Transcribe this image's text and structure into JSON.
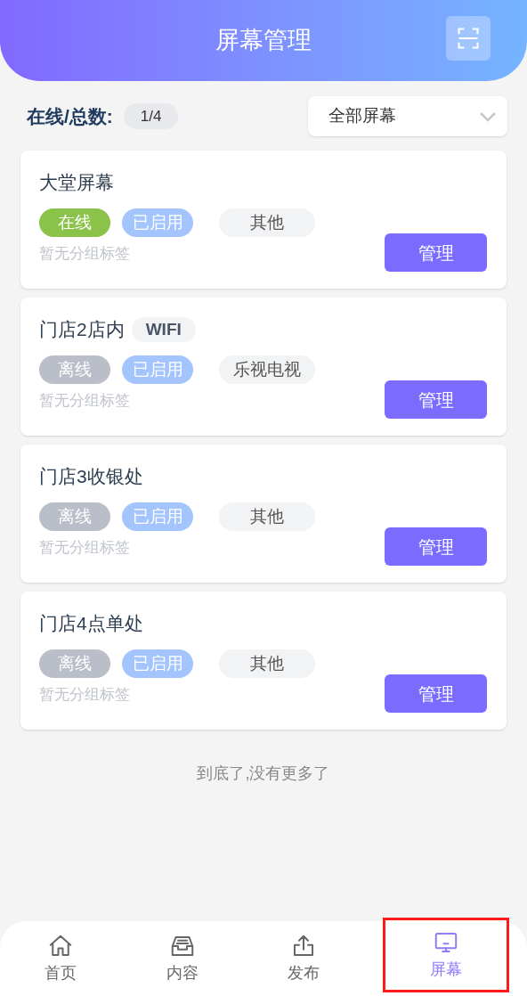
{
  "header": {
    "title": "屏幕管理"
  },
  "summary": {
    "label": "在线/总数:",
    "count": "1/4"
  },
  "filter": {
    "value": "全部屏幕"
  },
  "screens": [
    {
      "name": "大堂屏幕",
      "online": true,
      "status": "在线",
      "enabled": "已启用",
      "type": "其他",
      "group": "暂无分组标签",
      "action": "管理"
    },
    {
      "name": "门店2店内",
      "network": "WIFI",
      "online": false,
      "status": "离线",
      "enabled": "已启用",
      "type": "乐视电视",
      "group": "暂无分组标签",
      "action": "管理"
    },
    {
      "name": "门店3收银处",
      "online": false,
      "status": "离线",
      "enabled": "已启用",
      "type": "其他",
      "group": "暂无分组标签",
      "action": "管理"
    },
    {
      "name": "门店4点单处",
      "online": false,
      "status": "离线",
      "enabled": "已启用",
      "type": "其他",
      "group": "暂无分组标签",
      "action": "管理"
    }
  ],
  "end_note": "到底了,没有更多了",
  "nav": [
    {
      "kind": "home",
      "label": "首页",
      "selected": false,
      "highlighted": false
    },
    {
      "kind": "content",
      "label": "内容",
      "selected": false,
      "highlighted": false
    },
    {
      "kind": "publish",
      "label": "发布",
      "selected": false,
      "highlighted": false
    },
    {
      "kind": "screen",
      "label": "屏幕",
      "selected": true,
      "highlighted": true
    }
  ]
}
